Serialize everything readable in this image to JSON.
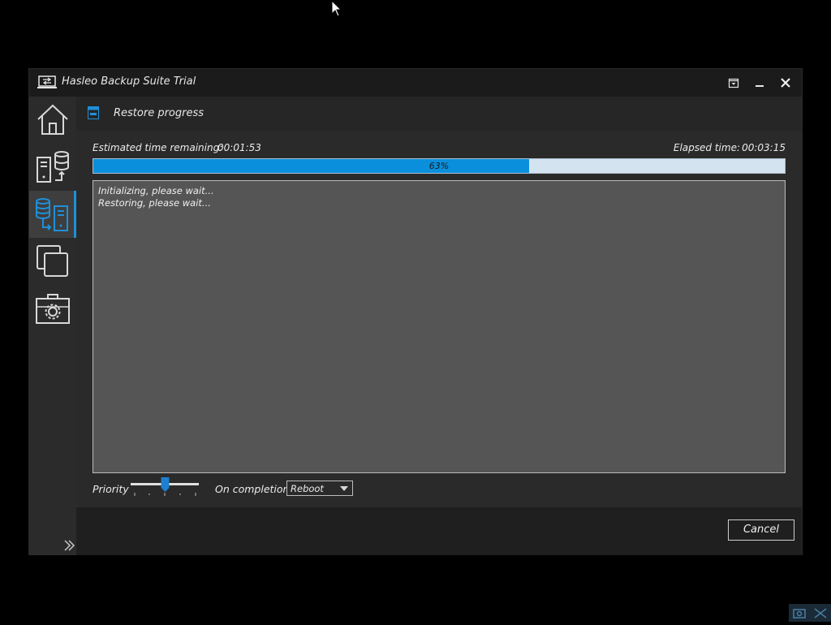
{
  "window": {
    "title": "Hasleo Backup Suite Trial"
  },
  "sidebar": {
    "items": [
      {
        "name": "home-icon"
      },
      {
        "name": "backup-icon"
      },
      {
        "name": "restore-icon",
        "active": true
      },
      {
        "name": "clone-icon"
      },
      {
        "name": "tools-icon"
      }
    ]
  },
  "header": {
    "title": "Restore progress"
  },
  "progress": {
    "estimated_label": "Estimated time remaining:",
    "estimated_value": "00:01:53",
    "elapsed_label": "Elapsed time:",
    "elapsed_value": "00:03:15",
    "percent_text": "63%",
    "percent": 63
  },
  "log": {
    "lines": [
      "Initializing, please wait...",
      "Restoring, please wait..."
    ]
  },
  "controls": {
    "priority_label": "Priority",
    "completion_label": "On completion",
    "completion_value": "Reboot",
    "priority_level_fraction": 0.5
  },
  "footer": {
    "cancel_label": "Cancel"
  },
  "colors": {
    "accent": "#0a8fdc",
    "progress_track": "#d4e3f0",
    "log_bg": "#555555"
  }
}
